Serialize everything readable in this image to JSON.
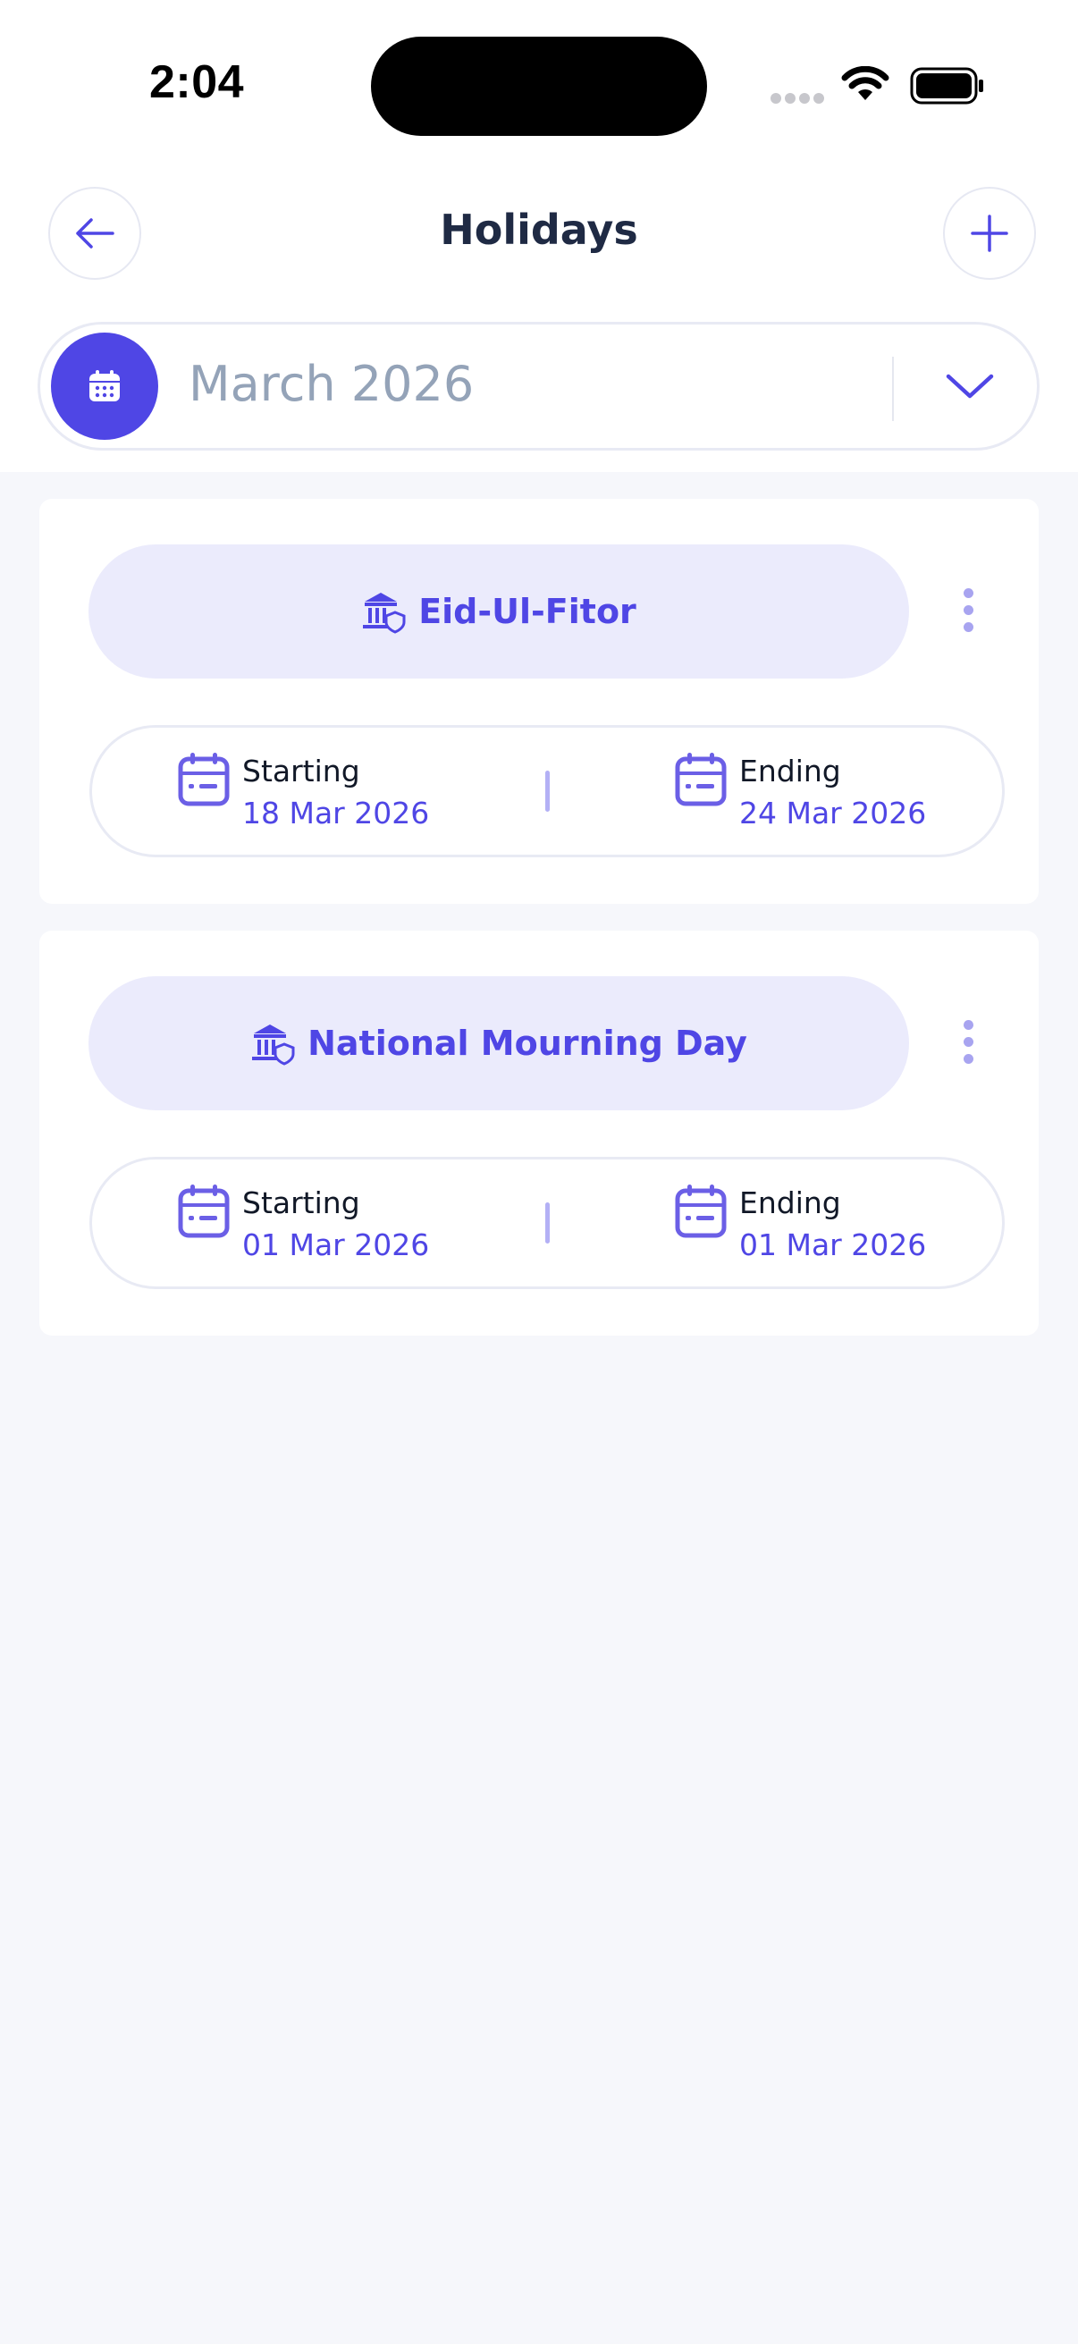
{
  "status_bar": {
    "time": "2:04"
  },
  "header": {
    "title": "Holidays",
    "back_icon": "arrow-left-icon",
    "add_icon": "plus-icon"
  },
  "month_selector": {
    "label": "March 2026",
    "icon": "calendar-icon",
    "chevron": "chevron-down-icon"
  },
  "colors": {
    "accent": "#4f46e5",
    "pill_bg": "#ebebfc",
    "page_bg": "#f6f7fb"
  },
  "holidays": [
    {
      "name": "Eid-Ul-Fitor",
      "icon": "bank-shield-icon",
      "starting_label": "Starting",
      "starting_date": "18 Mar 2026",
      "ending_label": "Ending",
      "ending_date": "24 Mar 2026"
    },
    {
      "name": "National Mourning Day",
      "icon": "bank-shield-icon",
      "starting_label": "Starting",
      "starting_date": "01 Mar 2026",
      "ending_label": "Ending",
      "ending_date": "01 Mar 2026"
    }
  ]
}
